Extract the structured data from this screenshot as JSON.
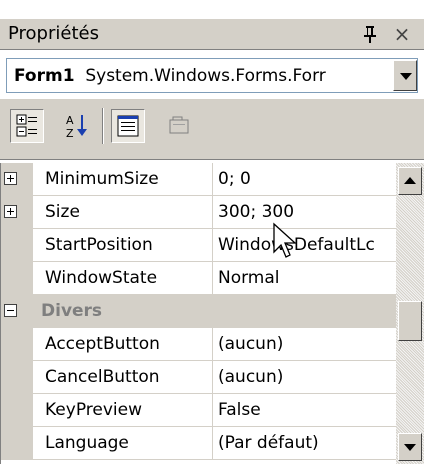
{
  "panel": {
    "title": "Propriétés",
    "pin_icon": "pushpin-icon",
    "close_glyph": "×"
  },
  "object_selector": {
    "object_name": "Form1",
    "object_type": "System.Windows.Forms.Forr"
  },
  "toolbar": {
    "buttons": [
      {
        "name": "categorized",
        "icon": "categorized-icon",
        "pressed": true
      },
      {
        "name": "alphabetical",
        "icon": "sort-az-icon",
        "pressed": false
      },
      {
        "name": "properties",
        "icon": "properties-icon",
        "pressed": true
      },
      {
        "name": "property-pages",
        "icon": "property-pages-icon",
        "pressed": false
      }
    ]
  },
  "grid": {
    "rows": [
      {
        "name": "MinimumSize",
        "value": "0; 0",
        "expander": "plus"
      },
      {
        "name": "Size",
        "value": "300; 300",
        "expander": "plus"
      },
      {
        "name": "StartPosition",
        "value": "WindowsDefaultLc"
      },
      {
        "name": "WindowState",
        "value": "Normal"
      }
    ],
    "category": {
      "label": "Divers",
      "expander": "minus"
    },
    "rows2": [
      {
        "name": "AcceptButton",
        "value": "(aucun)"
      },
      {
        "name": "CancelButton",
        "value": "(aucun)"
      },
      {
        "name": "KeyPreview",
        "value": "False"
      },
      {
        "name": "Language",
        "value": "(Par défaut)"
      }
    ]
  },
  "colors": {
    "chrome": "#d4d0c8",
    "border": "#808080",
    "category_text": "#7f7f7f"
  }
}
